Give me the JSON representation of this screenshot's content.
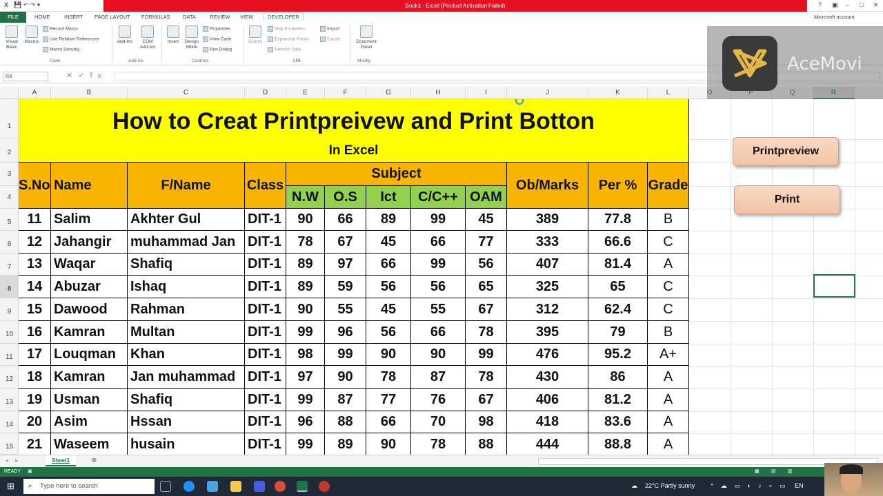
{
  "titlebar": {
    "title": "Book1 - Excel (Product Activation Failed)",
    "account": "Microsoft account",
    "win_help": "?",
    "win_min": "–",
    "win_max": "□",
    "win_close": "✕"
  },
  "tabs": {
    "file": "FILE",
    "home": "HOME",
    "insert": "INSERT",
    "page_layout": "PAGE LAYOUT",
    "formulas": "FORMULAS",
    "data": "DATA",
    "review": "REVIEW",
    "view": "VIEW",
    "developer": "DEVELOPER"
  },
  "ribbon": {
    "visual_basic": "Visual Basic",
    "macros": "Macros",
    "record_macro": "Record Macro",
    "relative_refs": "Use Relative References",
    "macro_security": "Macro Security",
    "group_code": "Code",
    "addins": "Add-Ins",
    "com_addins": "COM Add-Ins",
    "group_addins": "Add-ins",
    "insert": "Insert",
    "design_mode": "Design Mode",
    "properties": "Properties",
    "view_code": "View Code",
    "run_dialog": "Run Dialog",
    "group_controls": "Controls",
    "source": "Source",
    "map_properties": "Map Properties",
    "expansion_packs": "Expansion Packs",
    "refresh_data": "Refresh Data",
    "import": "Import",
    "export": "Export",
    "group_xml": "XML",
    "document_panel": "Document Panel",
    "group_modify": "Modify"
  },
  "formula": {
    "namebox": "R8",
    "fx": "fx"
  },
  "columns": [
    "A",
    "B",
    "C",
    "D",
    "E",
    "F",
    "G",
    "H",
    "I",
    "J",
    "K",
    "L",
    "O",
    "P",
    "Q",
    "R"
  ],
  "rows": [
    "1",
    "2",
    "3",
    "4",
    "5",
    "6",
    "7",
    "8",
    "9",
    "10",
    "11",
    "12",
    "13",
    "14",
    "15"
  ],
  "sheet": {
    "title": "How to Creat Printpreivew and Print Botton",
    "subtitle": "In Excel",
    "headers": {
      "sno": "S.No",
      "name": "Name",
      "fname": "F/Name",
      "class": "Class",
      "subject": "Subject",
      "obmarks": "Ob/Marks",
      "per": "Per %",
      "grade": "Grade"
    },
    "subjects": [
      "N.W",
      "O.S",
      "Ict",
      "C/C++",
      "OAM"
    ],
    "data_rows": [
      [
        "11",
        "Salim",
        "Akhter Gul",
        "DIT-1",
        "90",
        "66",
        "89",
        "99",
        "45",
        "389",
        "77.8",
        "B"
      ],
      [
        "12",
        "Jahangir",
        "muhammad Jan",
        "DIT-1",
        "78",
        "67",
        "45",
        "66",
        "77",
        "333",
        "66.6",
        "C"
      ],
      [
        "13",
        "Waqar",
        "Shafiq",
        "DIT-1",
        "89",
        "97",
        "66",
        "99",
        "56",
        "407",
        "81.4",
        "A"
      ],
      [
        "14",
        "Abuzar",
        "Ishaq",
        "DIT-1",
        "89",
        "59",
        "56",
        "56",
        "65",
        "325",
        "65",
        "C"
      ],
      [
        "15",
        "Dawood",
        "Rahman",
        "DIT-1",
        "90",
        "55",
        "45",
        "55",
        "67",
        "312",
        "62.4",
        "C"
      ],
      [
        "16",
        "Kamran",
        "Multan",
        "DIT-1",
        "99",
        "96",
        "56",
        "66",
        "78",
        "395",
        "79",
        "B"
      ],
      [
        "17",
        "Louqman",
        "Khan",
        "DIT-1",
        "98",
        "99",
        "90",
        "90",
        "99",
        "476",
        "95.2",
        "A+"
      ],
      [
        "18",
        "Kamran",
        "Jan muhammad",
        "DIT-1",
        "97",
        "90",
        "78",
        "87",
        "78",
        "430",
        "86",
        "A"
      ],
      [
        "19",
        "Usman",
        "Shafiq",
        "DIT-1",
        "99",
        "87",
        "77",
        "76",
        "67",
        "406",
        "81.2",
        "A"
      ],
      [
        "20",
        "Asim",
        "Hssan",
        "DIT-1",
        "96",
        "88",
        "66",
        "70",
        "98",
        "418",
        "83.6",
        "A"
      ],
      [
        "21",
        "Waseem",
        "husain",
        "DIT-1",
        "99",
        "89",
        "90",
        "78",
        "88",
        "444",
        "88.8",
        "A"
      ]
    ]
  },
  "buttons": {
    "printpreview": "Printpreview",
    "print": "Print"
  },
  "sheettabs": {
    "sheet1": "Sheet1",
    "add": "⊕"
  },
  "status": {
    "ready": "READY"
  },
  "taskbar": {
    "search_placeholder": "Type here to search",
    "weather": "22°C  Partly sunny",
    "lang": "EN"
  },
  "watermark": {
    "text": "AceMovi"
  },
  "colors": {
    "excel_green": "#217346",
    "title_yellow": "#ffff00",
    "header_orange": "#f7b500",
    "subject_green": "#92d050",
    "button_peach": "#f2c3a5"
  }
}
